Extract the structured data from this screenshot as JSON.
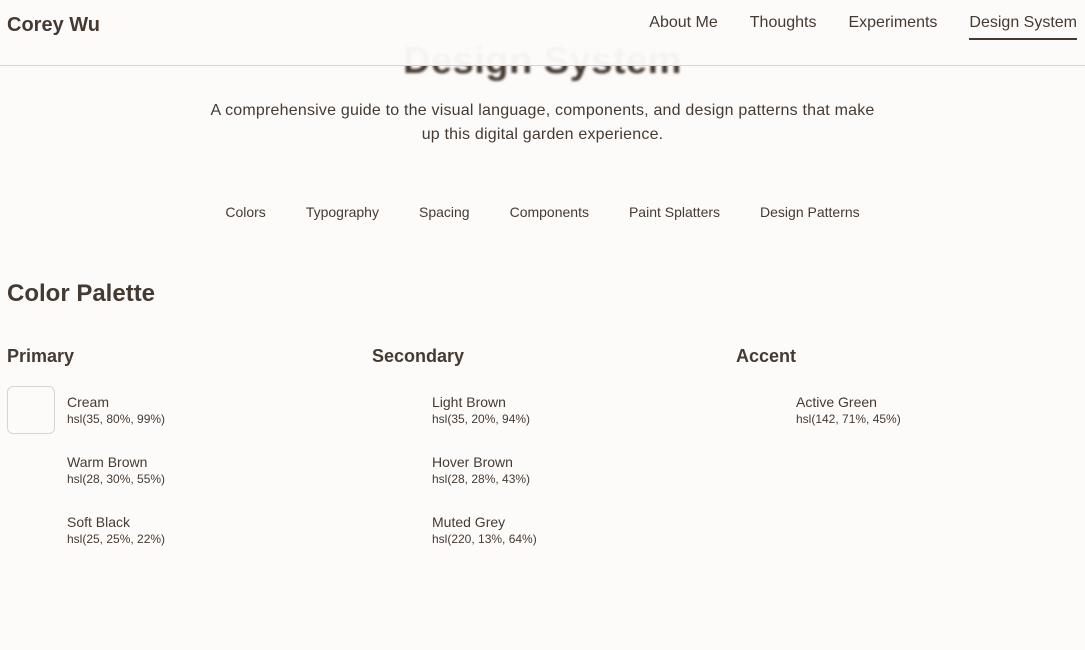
{
  "header": {
    "site_title": "Corey Wu",
    "nav": [
      {
        "label": "About Me"
      },
      {
        "label": "Thoughts"
      },
      {
        "label": "Experiments"
      },
      {
        "label": "Design System",
        "active": true
      }
    ]
  },
  "hero": {
    "title": "Design System",
    "description": "A comprehensive guide to the visual language, components, and design patterns that make up this digital garden experience."
  },
  "section_nav": [
    "Colors",
    "Typography",
    "Spacing",
    "Components",
    "Paint Splatters",
    "Design Patterns"
  ],
  "palette": {
    "heading": "Color Palette",
    "columns": [
      {
        "heading": "Primary",
        "colors": [
          {
            "name": "Cream",
            "value": "hsl(35, 80%, 99%)",
            "hex": "#fdfbf9"
          },
          {
            "name": "Warm Brown",
            "value": "hsl(28, 30%, 55%)",
            "hex": "#fdfbf9"
          },
          {
            "name": "Soft Black",
            "value": "hsl(25, 25%, 22%)",
            "hex": "#fdfbf9"
          }
        ]
      },
      {
        "heading": "Secondary",
        "colors": [
          {
            "name": "Light Brown",
            "value": "hsl(35, 20%, 94%)",
            "hex": "#fdfbf9"
          },
          {
            "name": "Hover Brown",
            "value": "hsl(28, 28%, 43%)",
            "hex": "#fdfbf9"
          },
          {
            "name": "Muted Grey",
            "value": "hsl(220, 13%, 64%)",
            "hex": "#fdfbf9"
          }
        ]
      },
      {
        "heading": "Accent",
        "colors": [
          {
            "name": "Active Green",
            "value": "hsl(142, 71%, 45%)",
            "hex": "#fdfbf9"
          }
        ]
      }
    ]
  },
  "theme": {
    "background": "#fdfbf9",
    "text": "#453a32",
    "border": "#d9d4cf"
  }
}
